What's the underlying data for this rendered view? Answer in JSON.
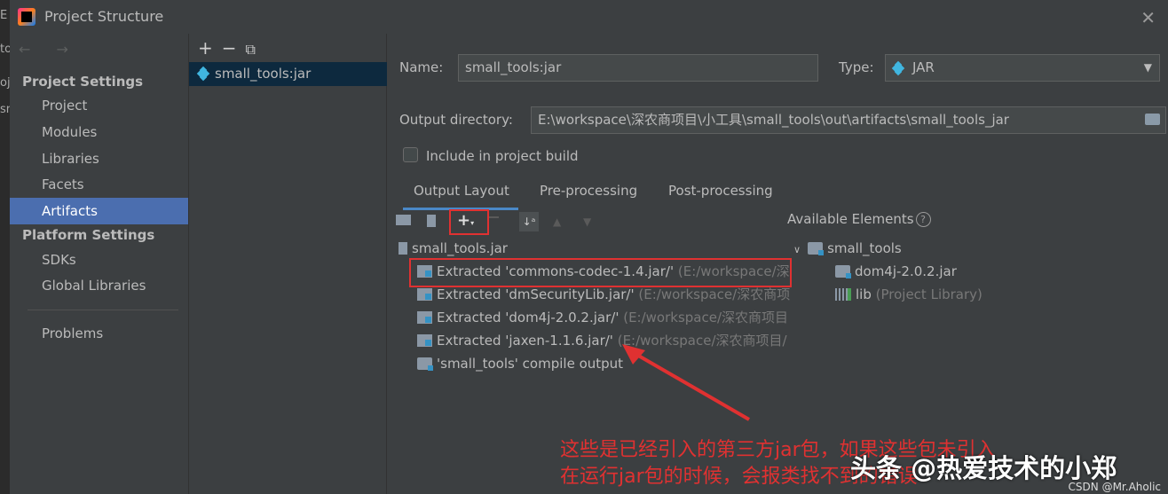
{
  "window": {
    "title": "Project Structure",
    "close_glyph": "✕"
  },
  "bg_editor": {
    "frag1": "E",
    "frag2": "to",
    "frag3": "oj",
    "frag4": "sn"
  },
  "nav": {
    "arrows": "← →",
    "project_settings_header": "Project Settings",
    "platform_settings_header": "Platform Settings",
    "items": [
      {
        "label": "Project"
      },
      {
        "label": "Modules"
      },
      {
        "label": "Libraries"
      },
      {
        "label": "Facets"
      },
      {
        "label": "Artifacts",
        "selected": true
      },
      {
        "label": "SDKs"
      },
      {
        "label": "Global Libraries"
      },
      {
        "label": "Problems"
      }
    ]
  },
  "artifact_list": {
    "toolbar": {
      "add": "+",
      "remove": "−",
      "copy": "⧉"
    },
    "items": [
      {
        "label": "small_tools:jar"
      }
    ]
  },
  "artifact": {
    "name_label": "Name:",
    "name_value": "small_tools:jar",
    "type_label": "Type:",
    "type_value": "JAR",
    "output_dir_label": "Output directory:",
    "output_dir_value": "E:\\workspace\\深农商项目\\小工具\\small_tools\\out\\artifacts\\small_tools_jar",
    "include_in_build_label": "Include in project build",
    "include_in_build_checked": false
  },
  "tabs": [
    {
      "label": "Output Layout",
      "active": true
    },
    {
      "label": "Pre-processing"
    },
    {
      "label": "Post-processing"
    }
  ],
  "layout_tree": {
    "root": "small_tools.jar",
    "children": [
      {
        "label": "Extracted 'commons-codec-1.4.jar/'",
        "path": "(E:/workspace/深"
      },
      {
        "label": "Extracted 'dmSecurityLib.jar/'",
        "path": "(E:/workspace/深农商项"
      },
      {
        "label": "Extracted 'dom4j-2.0.2.jar/'",
        "path": "(E:/workspace/深农商项目"
      },
      {
        "label": "Extracted 'jaxen-1.1.6.jar/'",
        "path": "(E:/workspace/深农商项目/"
      },
      {
        "label": "'small_tools' compile output",
        "path": ""
      }
    ]
  },
  "available": {
    "header": "Available Elements",
    "help": "?",
    "root": "small_tools",
    "children": [
      {
        "label": "dom4j-2.0.2.jar",
        "suffix": ""
      },
      {
        "label": "lib",
        "suffix": "(Project Library)"
      }
    ]
  },
  "annotation": {
    "line1": "这些是已经引入的第三方jar包，如果这些包未引入",
    "line2": "在运行jar包的时候，会报类找不到的错误",
    "color": "#e03131"
  },
  "watermark": {
    "text": "头条 @热爱技术的小郑",
    "csdn": "CSDN @Mr.Aholic"
  },
  "colors": {
    "selection": "#4b6eaf",
    "accent": "#40b6e0",
    "panel": "#3c3f41",
    "tab_underline": "#4a88c7"
  }
}
